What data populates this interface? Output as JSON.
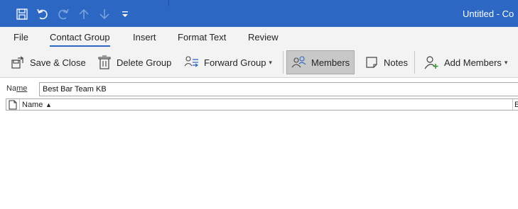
{
  "window": {
    "title": "Untitled - Co"
  },
  "qat": {
    "save": "save-icon",
    "undo": "undo-icon",
    "redo": "redo-icon",
    "up": "up-arrow-icon",
    "down": "down-arrow-icon",
    "customize": "customize-qat-icon"
  },
  "menu": {
    "tabs": [
      {
        "label": "File"
      },
      {
        "label": "Contact Group"
      },
      {
        "label": "Insert"
      },
      {
        "label": "Format Text"
      },
      {
        "label": "Review"
      }
    ]
  },
  "ribbon": {
    "save_close": "Save & Close",
    "delete_group": "Delete Group",
    "forward_group": "Forward Group",
    "members": "Members",
    "notes": "Notes",
    "add_members": "Add Members"
  },
  "form": {
    "name_label_underlined": "Na",
    "name_label_rest": "me",
    "name_value": "Best Bar Team KB"
  },
  "grid": {
    "columns": [
      {
        "label": "Name",
        "sort": "▲"
      },
      {
        "label": "E"
      }
    ]
  },
  "colors": {
    "titlebar": "#2b67c3",
    "ribbon": "#f3f3f3"
  }
}
